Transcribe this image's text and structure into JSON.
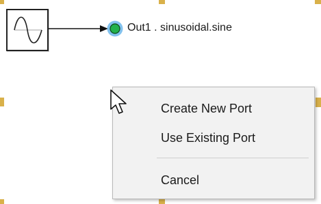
{
  "diagram": {
    "source_block": {
      "icon": "sine-wave-icon"
    },
    "port": {
      "label": "Out1 . sinusoidal.sine",
      "indicator_color": "#22b14c",
      "highlight_color": "#5aaee8"
    },
    "selection_handle_color": "#d9b14a"
  },
  "context_menu": {
    "items": [
      {
        "label": "Create New Port"
      },
      {
        "label": "Use Existing Port"
      },
      {
        "label": "Cancel"
      }
    ]
  }
}
